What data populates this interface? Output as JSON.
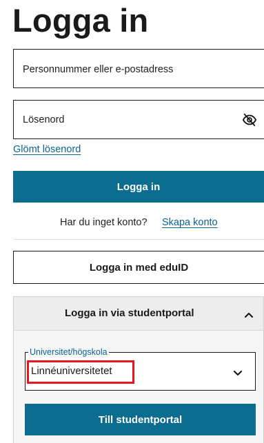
{
  "page": {
    "title": "Logga in"
  },
  "login": {
    "username_placeholder": "Personnummer eller e-postadress",
    "password_placeholder": "Lösenord",
    "forgot_password": "Glömt lösenord",
    "submit_label": "Logga in"
  },
  "signup": {
    "prompt": "Har du inget konto?",
    "link": "Skapa konto"
  },
  "eduid": {
    "button_label": "Logga in med eduID"
  },
  "student_portal": {
    "header_label": "Logga in via studentportal",
    "expanded": true,
    "select_legend": "Universitet/högskola",
    "select_value": "Linnéuniversitetet",
    "submit_label": "Till studentportal"
  },
  "icons": {
    "password_toggle": "eye-slash-icon",
    "collapse": "chevron-up-icon",
    "select_arrow": "chevron-down-icon"
  },
  "colors": {
    "primary": "#0d6d90",
    "link": "#0b6390",
    "highlight": "#e8141e"
  }
}
